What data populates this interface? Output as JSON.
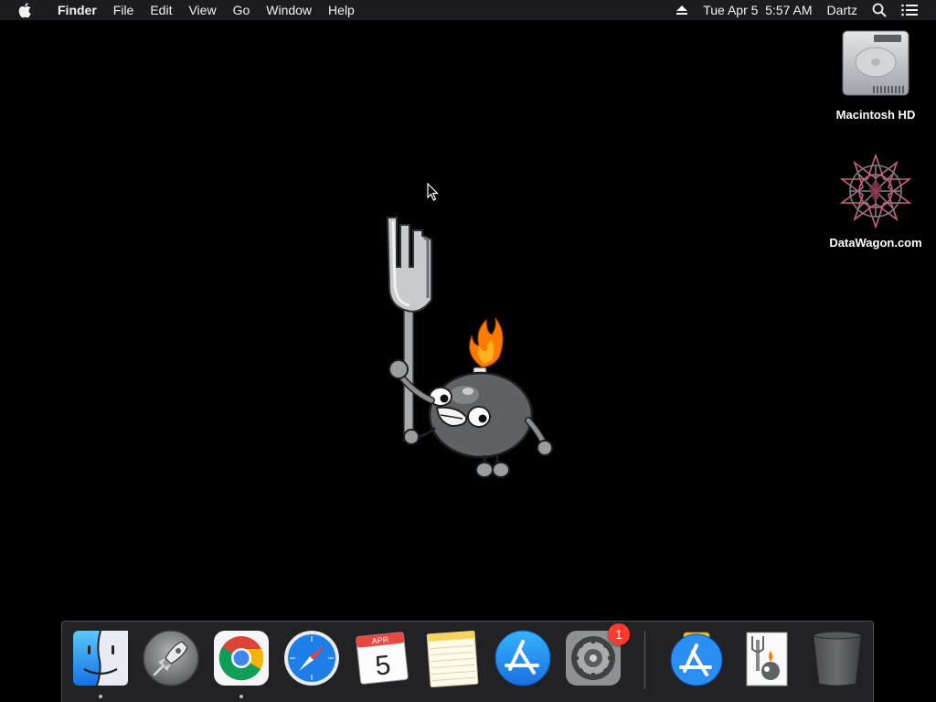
{
  "menubar": {
    "apple_icon": "apple-logo-icon",
    "app_name": "Finder",
    "menus": [
      "File",
      "Edit",
      "View",
      "Go",
      "Window",
      "Help"
    ],
    "status": {
      "eject_icon": "eject-icon",
      "clock": "Tue Apr 5  5:57 AM",
      "user": "Dartz",
      "search_icon": "spotlight-search-icon",
      "notification_icon": "notification-center-icon"
    }
  },
  "desktop": {
    "icons": [
      {
        "label": "Macintosh HD",
        "icon": "hard-drive-icon"
      },
      {
        "label": "DataWagon.com",
        "icon": "datawagon-star-icon"
      }
    ],
    "wallpaper": "bomb-character-holding-fork"
  },
  "dock": {
    "apps": [
      {
        "name": "Finder",
        "icon": "finder-icon",
        "running": true
      },
      {
        "name": "Launchpad",
        "icon": "launchpad-rocket-icon",
        "running": false
      },
      {
        "name": "Google Chrome",
        "icon": "chrome-icon",
        "running": true
      },
      {
        "name": "Safari",
        "icon": "safari-compass-icon",
        "running": false
      },
      {
        "name": "Calendar",
        "icon": "calendar-icon",
        "month": "APR",
        "day": "5",
        "running": false
      },
      {
        "name": "Notes",
        "icon": "notes-icon",
        "running": false
      },
      {
        "name": "App Store",
        "icon": "app-store-icon",
        "running": false
      },
      {
        "name": "System Preferences",
        "icon": "system-preferences-gear-icon",
        "badge": "1",
        "running": false
      }
    ],
    "others": [
      {
        "name": "App Store Downloads",
        "icon": "app-store-folder-icon"
      },
      {
        "name": "Wallpaper Image",
        "icon": "bomb-thumbnail-icon"
      },
      {
        "name": "Trash",
        "icon": "trash-icon"
      }
    ]
  },
  "colors": {
    "menubar_bg": "#1c1c1e",
    "desktop_bg": "#000000",
    "dock_bg": "#28282a",
    "badge": "#ff3b30",
    "app_store_blue": "#1e8ef0",
    "flame_orange": "#ff7a00"
  }
}
